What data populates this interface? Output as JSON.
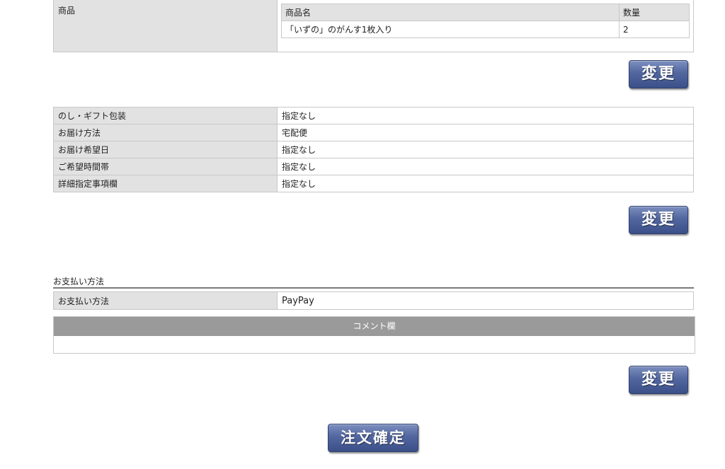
{
  "products": {
    "label": "商品",
    "columns": [
      "商品名",
      "数量"
    ],
    "items": [
      {
        "name": "「いずの」のがんす1枚入り",
        "quantity": "2"
      }
    ]
  },
  "change_label": "変更",
  "delivery": {
    "rows": [
      {
        "label": "のし・ギフト包装",
        "value": "指定なし"
      },
      {
        "label": "お届け方法",
        "value": "宅配便"
      },
      {
        "label": "お届け希望日",
        "value": "指定なし"
      },
      {
        "label": "ご希望時間帯",
        "value": "指定なし"
      },
      {
        "label": "詳細指定事項欄",
        "value": "指定なし"
      }
    ]
  },
  "payment": {
    "section_title": "お支払い方法",
    "label": "お支払い方法",
    "value": "PayPay"
  },
  "comment": {
    "heading": "コメント欄",
    "body": ""
  },
  "confirm_label": "注文確定"
}
